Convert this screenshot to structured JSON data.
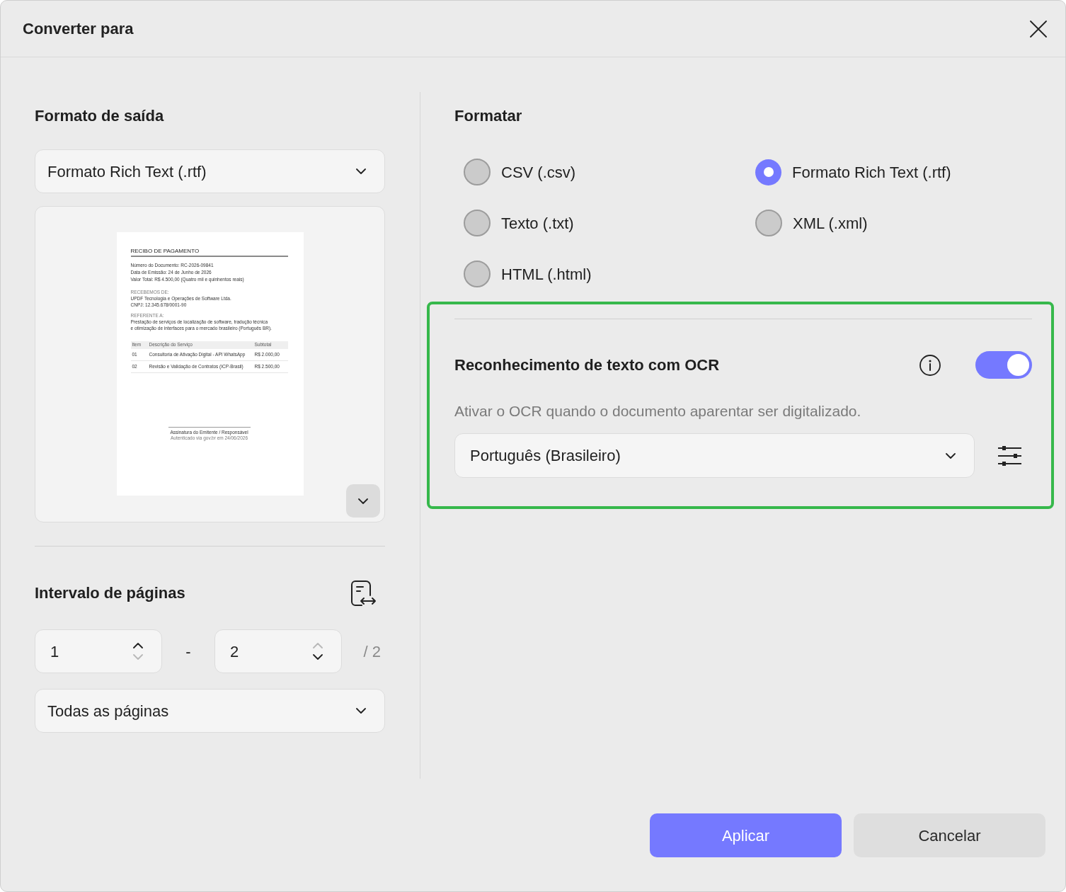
{
  "window": {
    "title": "Converter para"
  },
  "output_format": {
    "heading": "Formato de saída",
    "dropdown": {
      "value": "Formato Rich Text (.rtf)"
    },
    "preview": {
      "title": "RECIBO DE PAGAMENTO",
      "details": [
        "Número do Documento: RC-2026-09841",
        "Data de Emissão: 24 de Junho de 2026",
        "Valor Total: R$ 4.500,00 (Quatro mil e quinhentos reais)"
      ],
      "sections": [
        {
          "label": "RECEBEMOS DE:",
          "lines": [
            "UPDF Tecnologia e Operações de Software Ltda.",
            "CNPJ: 12.345.678/0001-90"
          ]
        },
        {
          "label": "REFERENTE A:",
          "lines": [
            "Prestação de serviços de localização de software, tradução técnica",
            "e otimização de interfaces para o mercado brasileiro (Português BR)."
          ]
        }
      ],
      "table": {
        "columns": [
          "Item",
          "Descrição do Serviço",
          "Subtotal"
        ],
        "rows": [
          [
            "01",
            "Consultoria de Ativação Digital - API WhatsApp",
            "R$ 2.000,00"
          ],
          [
            "02",
            "Revisão e Validação de Contratos (ICP-Brasil)",
            "R$ 2.500,00"
          ]
        ]
      },
      "signature": "Assinatura do Emitente / Responsável",
      "note": "Autenticado via gov.br em 24/06/2026"
    }
  },
  "page_range": {
    "heading": "Intervalo de páginas",
    "from": {
      "value": "1",
      "up_disabled": false,
      "down_disabled": true
    },
    "separator": "-",
    "to": {
      "value": "2",
      "up_disabled": true,
      "down_disabled": false
    },
    "total": "/ 2",
    "dropdown": {
      "value": "Todas as páginas"
    }
  },
  "format": {
    "heading": "Formatar",
    "options": [
      {
        "label": "CSV (.csv)",
        "selected": false
      },
      {
        "label": "Formato Rich Text (.rtf)",
        "selected": true
      },
      {
        "label": "Texto (.txt)",
        "selected": false
      },
      {
        "label": "XML (.xml)",
        "selected": false
      },
      {
        "label": "HTML (.html)",
        "selected": false
      }
    ]
  },
  "ocr": {
    "highlighted": true,
    "title": "Reconhecimento de texto com OCR",
    "on": true,
    "description": "Ativar o OCR quando o documento aparentar ser digitalizado.",
    "language": {
      "value": "Português (Brasileiro)"
    }
  },
  "buttons": [
    {
      "label": "Aplicar",
      "kind": "primary"
    },
    {
      "label": "Cancelar",
      "kind": "secondary"
    }
  ]
}
